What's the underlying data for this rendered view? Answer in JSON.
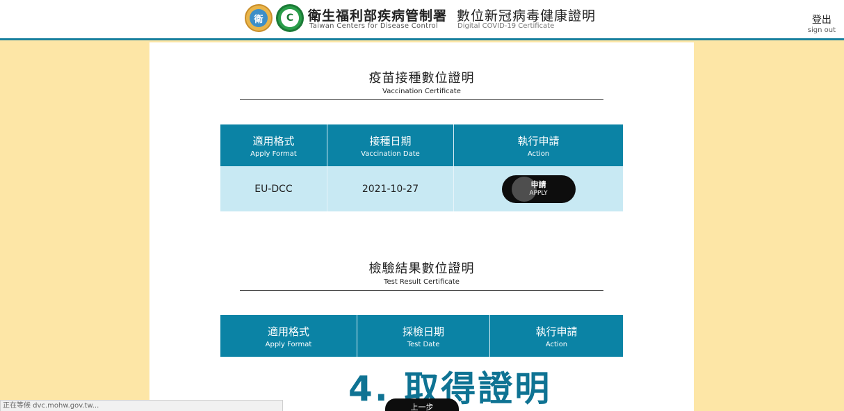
{
  "header": {
    "org_name_zh": "衛生福利部疾病管制署",
    "org_name_en": "Taiwan Centers for Disease Control",
    "cert_title_zh": "數位新冠病毒健康證明",
    "cert_title_en": "Digital COVID-19 Certificate",
    "signout_zh": "登出",
    "signout_en": "sign out",
    "logos": [
      "moh-seal-icon",
      "cdc-logo-icon"
    ]
  },
  "vaccination": {
    "title_zh": "疫苗接種數位證明",
    "title_en": "Vaccination Certificate",
    "columns": [
      {
        "zh": "適用格式",
        "en": "Apply Format"
      },
      {
        "zh": "接種日期",
        "en": "Vaccination Date"
      },
      {
        "zh": "執行申請",
        "en": "Action"
      }
    ],
    "rows": [
      {
        "format": "EU-DCC",
        "date": "2021-10-27",
        "action_zh": "申請",
        "action_en": "APPLY"
      }
    ]
  },
  "test_result": {
    "title_zh": "檢驗結果數位證明",
    "title_en": "Test Result Certificate",
    "columns": [
      {
        "zh": "適用格式",
        "en": "Apply Format"
      },
      {
        "zh": "採檢日期",
        "en": "Test Date"
      },
      {
        "zh": "執行申請",
        "en": "Action"
      }
    ]
  },
  "step_caption": "4. 取得證明",
  "back_button": "上一步",
  "status_bar": "正在等候 dvc.mohw.gov.tw...",
  "colors": {
    "background": "#fde6a6",
    "table_header": "#0b83a5",
    "table_row": "#c8e9f3",
    "header_rule": "#19809e",
    "caption": "#0f7393"
  }
}
